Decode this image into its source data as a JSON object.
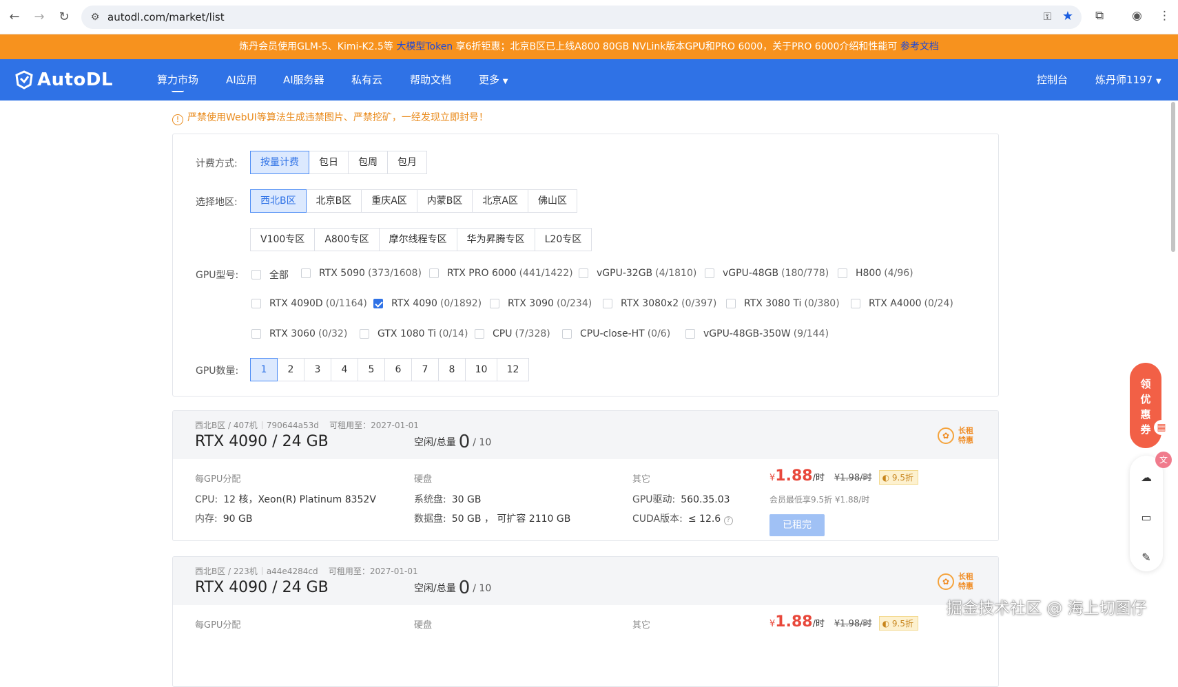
{
  "browser": {
    "url": "autodl.com/market/list"
  },
  "notice": {
    "text_before": "炼丹会员使用GLM-5、Kimi-K2.5等",
    "link1": "大模型Token",
    "text_middle": "享6折钜惠；北京B区已上线A800 80GB NVLink版本GPU和PRO 6000，关于PRO 6000介绍和性能可",
    "link2": "参考文档"
  },
  "header": {
    "logo_text": "AutoDL",
    "menu": [
      "算力市场",
      "AI应用",
      "AI服务器",
      "私有云",
      "帮助文档",
      "更多"
    ],
    "console": "控制台",
    "user": "炼丹师1197"
  },
  "warning": "严禁使用WebUI等算法生成违禁图片、严禁挖矿，一经发现立即封号！",
  "filters": {
    "billing_label": "计费方式:",
    "billing": [
      "按量计费",
      "包日",
      "包周",
      "包月"
    ],
    "region_label": "选择地区:",
    "regions": [
      "西北B区",
      "北京B区",
      "重庆A区",
      "内蒙B区",
      "北京A区",
      "佛山区"
    ],
    "zones": [
      "V100专区",
      "A800专区",
      "摩尔线程专区",
      "华为昇腾专区",
      "L20专区"
    ],
    "gpu_label": "GPU型号:",
    "gpus": [
      {
        "name": "全部",
        "count": ""
      },
      {
        "name": "RTX 5090",
        "count": "(373/1608)"
      },
      {
        "name": "RTX PRO 6000",
        "count": "(441/1422)"
      },
      {
        "name": "vGPU-32GB",
        "count": "(4/1810)"
      },
      {
        "name": "vGPU-48GB",
        "count": "(180/778)"
      },
      {
        "name": "H800",
        "count": "(4/96)"
      },
      {
        "name": "RTX 4090D",
        "count": "(0/1164)"
      },
      {
        "name": "RTX 4090",
        "count": "(0/1892)"
      },
      {
        "name": "RTX 3090",
        "count": "(0/234)"
      },
      {
        "name": "RTX 3080x2",
        "count": "(0/397)"
      },
      {
        "name": "RTX 3080 Ti",
        "count": "(0/380)"
      },
      {
        "name": "RTX A4000",
        "count": "(0/24)"
      },
      {
        "name": "RTX 3060",
        "count": "(0/32)"
      },
      {
        "name": "GTX 1080 Ti",
        "count": "(0/14)"
      },
      {
        "name": "CPU",
        "count": "(7/328)"
      },
      {
        "name": "CPU-close-HT",
        "count": "(0/6)"
      },
      {
        "name": "vGPU-48GB-350W",
        "count": "(9/144)"
      }
    ],
    "count_label": "GPU数量:",
    "counts": [
      "1",
      "2",
      "3",
      "4",
      "5",
      "6",
      "7",
      "8",
      "10",
      "12"
    ]
  },
  "cards": [
    {
      "region": "西北B区",
      "machine": "407机",
      "id": "790644a53d",
      "until": "可租用至：2027-01-01",
      "title": "RTX 4090 / 24 GB",
      "avail_label": "空闲/总量",
      "free": "0",
      "total": "/ 10",
      "promo1": "长租",
      "promo2": "特惠",
      "col1_h": "每GPU分配",
      "cpu_k": "CPU:",
      "cpu_v": "12 核，Xeon(R) Platinum 8352V",
      "mem_k": "内存:",
      "mem_v": "90 GB",
      "col2_h": "硬盘",
      "sys_k": "系统盘:",
      "sys_v": "30 GB",
      "data_k": "数据盘:",
      "data_v": "50 GB ， 可扩容 2110 GB",
      "col3_h": "其它",
      "drv_k": "GPU驱动:",
      "drv_v": "560.35.03",
      "cuda_k": "CUDA版本:",
      "cuda_v": "≤ 12.6",
      "currency": "¥",
      "price": "1.88",
      "unit": "/时",
      "old": "¥1.98/时",
      "discount": "9.5折",
      "note": "会员最低享9.5折 ¥1.88/时",
      "rented": "已租完"
    },
    {
      "region": "西北B区",
      "machine": "223机",
      "id": "a44e4284cd",
      "until": "可租用至：2027-01-01",
      "title": "RTX 4090 / 24 GB",
      "avail_label": "空闲/总量",
      "free": "0",
      "total": "/ 10",
      "promo1": "长租",
      "promo2": "特惠",
      "col1_h": "每GPU分配",
      "col2_h": "硬盘",
      "col3_h": "其它",
      "currency": "¥",
      "price": "1.88",
      "unit": "/时",
      "old": "¥1.98/时",
      "discount": "9.5折"
    }
  ],
  "side": {
    "coupon": [
      "领",
      "优",
      "惠",
      "券"
    ]
  },
  "watermark": "掘金技术社区 @ 海上切图仔"
}
